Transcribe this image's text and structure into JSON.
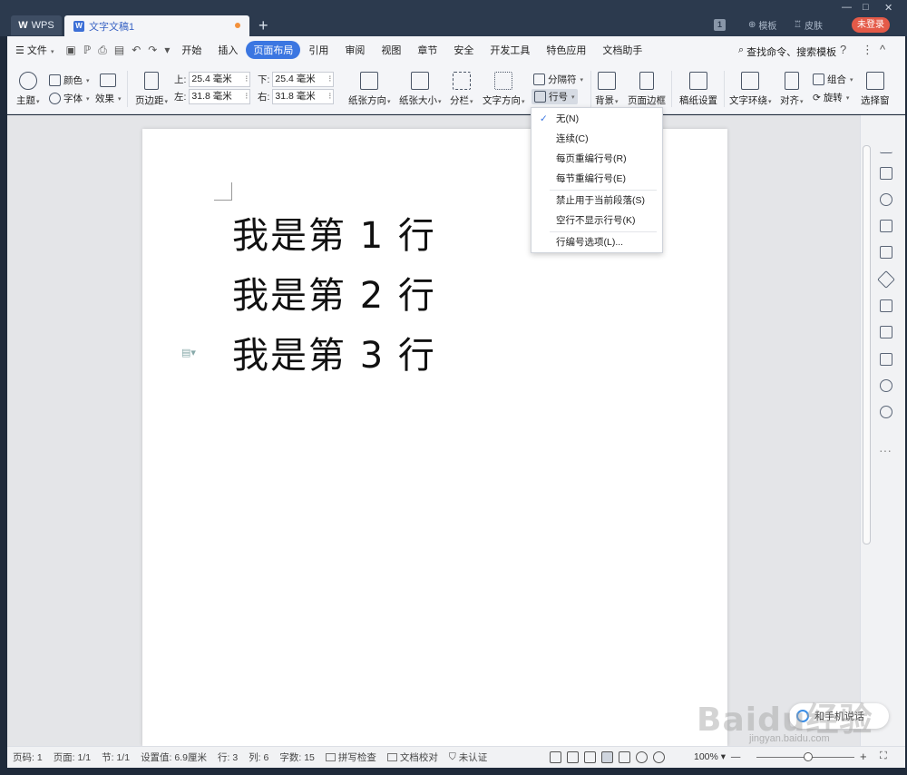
{
  "titlebar": {
    "wps_label": "WPS",
    "doc_tab": "文字文稿1",
    "add_tab": "+",
    "badge": "1",
    "template": "模板",
    "skin": "皮肤",
    "login": "未登录",
    "win_min": "—",
    "win_max": "□",
    "win_close": "✕"
  },
  "menubar": {
    "file": "文件",
    "items": [
      "开始",
      "插入",
      "页面布局",
      "引用",
      "审阅",
      "视图",
      "章节",
      "安全",
      "开发工具",
      "特色应用",
      "文档助手"
    ],
    "active": "页面布局",
    "search": "查找命令、搜索模板",
    "help": "?",
    "more": "⋮",
    "collapse": "^"
  },
  "ribbon": {
    "theme": "主题",
    "color": "颜色",
    "font": "字体",
    "effect": "效果",
    "margins": "页边距",
    "top_label": "上:",
    "top_val": "25.4 毫米",
    "bottom_label": "下:",
    "bottom_val": "25.4 毫米",
    "left_label": "左:",
    "left_val": "31.8 毫米",
    "right_label": "右:",
    "right_val": "31.8 毫米",
    "orientation": "纸张方向",
    "size": "纸张大小",
    "columns": "分栏",
    "text_direction": "文字方向",
    "breaks": "分隔符",
    "line_numbers": "行号",
    "background": "背景",
    "page_border": "页面边框",
    "paper_setup": "稿纸设置",
    "wrap": "文字环绕",
    "align": "对齐",
    "group": "组合",
    "rotate": "旋转",
    "selection_pane": "选择窗"
  },
  "dropdown": {
    "items": [
      "无(N)",
      "连续(C)",
      "每页重编行号(R)",
      "每节重编行号(E)",
      "禁止用于当前段落(S)",
      "空行不显示行号(K)",
      "行编号选项(L)..."
    ],
    "checked": "✓"
  },
  "document": {
    "lines": [
      "我是第 1 行",
      "我是第 2 行",
      "我是第 3 行"
    ]
  },
  "statusbar": {
    "page": "页码: 1",
    "pages": "页面: 1/1",
    "section": "节: 1/1",
    "position": "设置值: 6.9厘米",
    "row": "行: 3",
    "col": "列: 6",
    "words": "字数: 15",
    "spell": "拼写检查",
    "proof": "文档校对",
    "auth": "未认证",
    "zoom": "100%"
  },
  "overlay": {
    "watermark": "Baidu经验",
    "watermark_sub": "jingyan.baidu.com",
    "voice": "和手机说话"
  },
  "colors": {
    "accent": "#3b76e1",
    "login": "#e45a48",
    "titlebar": "#2c3a4e"
  }
}
